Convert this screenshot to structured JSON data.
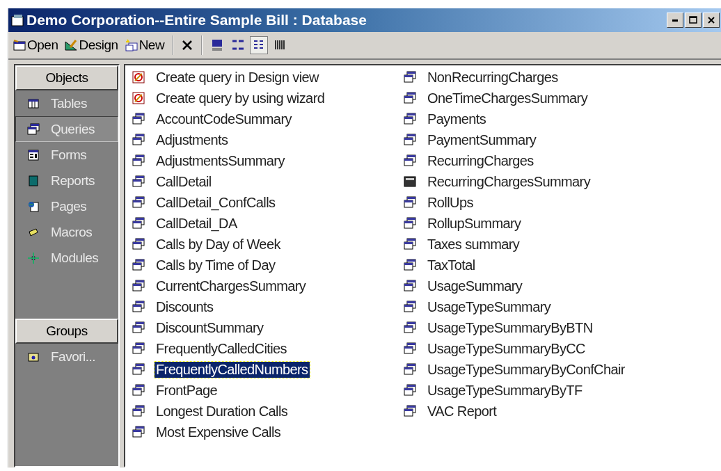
{
  "window": {
    "title": "Demo Corporation--Entire Sample Bill : Database"
  },
  "toolbar": {
    "buttons": [
      {
        "kind": "open",
        "label": "Open"
      },
      {
        "kind": "design",
        "label": "Design"
      },
      {
        "kind": "new",
        "label": "New"
      }
    ],
    "views": [
      {
        "kind": "large",
        "selected": false
      },
      {
        "kind": "small",
        "selected": false
      },
      {
        "kind": "list",
        "selected": true
      },
      {
        "kind": "details",
        "selected": false
      }
    ]
  },
  "sidebar": {
    "objects_header": "Objects",
    "items": [
      {
        "kind": "tables",
        "label": "Tables",
        "selected": false
      },
      {
        "kind": "queries",
        "label": "Queries",
        "selected": true
      },
      {
        "kind": "forms",
        "label": "Forms",
        "selected": false
      },
      {
        "kind": "reports",
        "label": "Reports",
        "selected": false
      },
      {
        "kind": "pages",
        "label": "Pages",
        "selected": false
      },
      {
        "kind": "macros",
        "label": "Macros",
        "selected": false
      },
      {
        "kind": "modules",
        "label": "Modules",
        "selected": false
      }
    ],
    "groups_header": "Groups",
    "groups": [
      {
        "label": "Favori...",
        "selected": false
      }
    ]
  },
  "list": {
    "columns": [
      [
        {
          "kind": "create",
          "label": "Create query in Design view",
          "selected": false
        },
        {
          "kind": "create",
          "label": "Create query by using wizard",
          "selected": false
        },
        {
          "kind": "query",
          "label": "AccountCodeSummary",
          "selected": false
        },
        {
          "kind": "query",
          "label": "Adjustments",
          "selected": false
        },
        {
          "kind": "query",
          "label": "AdjustmentsSummary",
          "selected": false
        },
        {
          "kind": "query",
          "label": "CallDetail",
          "selected": false
        },
        {
          "kind": "query",
          "label": "CallDetail_ConfCalls",
          "selected": false
        },
        {
          "kind": "query",
          "label": "CallDetail_DA",
          "selected": false
        },
        {
          "kind": "query",
          "label": "Calls by Day of Week",
          "selected": false
        },
        {
          "kind": "query",
          "label": "Calls by Time of Day",
          "selected": false
        },
        {
          "kind": "query",
          "label": "CurrentChargesSummary",
          "selected": false
        },
        {
          "kind": "query",
          "label": "Discounts",
          "selected": false
        },
        {
          "kind": "query",
          "label": "DiscountSummary",
          "selected": false
        },
        {
          "kind": "query",
          "label": "FrequentlyCalledCities",
          "selected": false
        },
        {
          "kind": "query",
          "label": "FrequentlyCalledNumbers",
          "selected": true
        },
        {
          "kind": "query",
          "label": "FrontPage",
          "selected": false
        },
        {
          "kind": "query",
          "label": "Longest Duration Calls",
          "selected": false
        },
        {
          "kind": "query",
          "label": "Most Expensive Calls",
          "selected": false
        }
      ],
      [
        {
          "kind": "query",
          "label": "NonRecurringCharges",
          "selected": false
        },
        {
          "kind": "query",
          "label": "OneTimeChargesSummary",
          "selected": false
        },
        {
          "kind": "query",
          "label": "Payments",
          "selected": false
        },
        {
          "kind": "query",
          "label": "PaymentSummary",
          "selected": false
        },
        {
          "kind": "query",
          "label": "RecurringCharges",
          "selected": false
        },
        {
          "kind": "crosstab",
          "label": "RecurringChargesSummary",
          "selected": false
        },
        {
          "kind": "query",
          "label": "RollUps",
          "selected": false
        },
        {
          "kind": "query",
          "label": "RollupSummary",
          "selected": false
        },
        {
          "kind": "query",
          "label": "Taxes summary",
          "selected": false
        },
        {
          "kind": "query",
          "label": "TaxTotal",
          "selected": false
        },
        {
          "kind": "query",
          "label": "UsageSummary",
          "selected": false
        },
        {
          "kind": "query",
          "label": "UsageTypeSummary",
          "selected": false
        },
        {
          "kind": "query",
          "label": "UsageTypeSummaryByBTN",
          "selected": false
        },
        {
          "kind": "query",
          "label": "UsageTypeSummaryByCC",
          "selected": false
        },
        {
          "kind": "query",
          "label": "UsageTypeSummaryByConfChair",
          "selected": false
        },
        {
          "kind": "query",
          "label": "UsageTypeSummaryByTF",
          "selected": false
        },
        {
          "kind": "query",
          "label": "VAC Report",
          "selected": false
        }
      ]
    ]
  }
}
